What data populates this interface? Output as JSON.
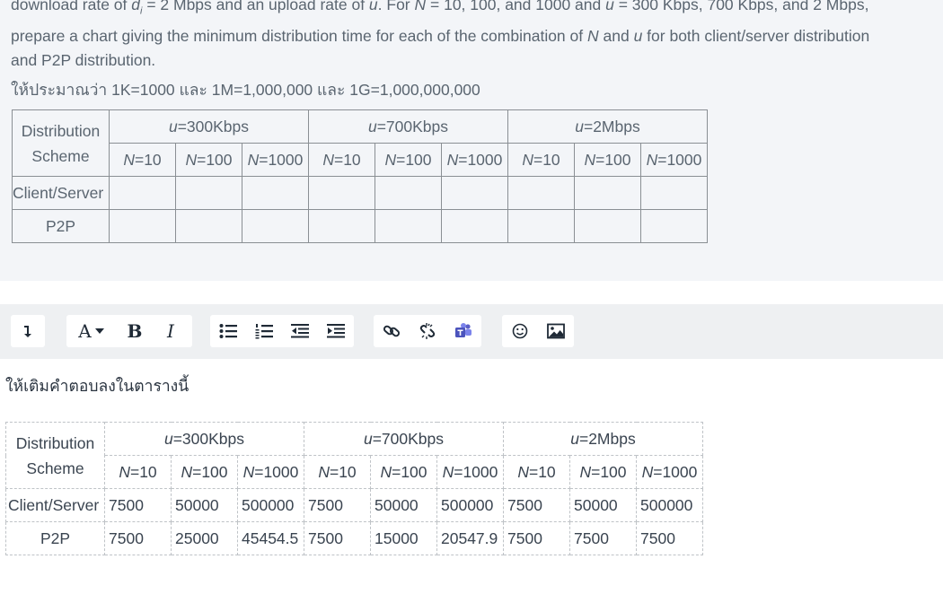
{
  "question": {
    "line1_a": "download rate of ",
    "line1_di": "d",
    "line1_di_sub": "i",
    "line1_b": " = 2 Mbps and an upload rate of ",
    "line1_u": "u",
    "line1_c": ". For ",
    "line1_N": "N",
    "line1_d": " = 10, 100, and 1000 and ",
    "line1_u2": "u",
    "line1_e": " = 300 Kbps, 700 Kbps, and 2 Mbps,",
    "line2_a": "prepare a chart giving the minimum distribution time for each of the combination of ",
    "line2_N": "N",
    "line2_b": " and ",
    "line2_u": "u",
    "line2_c": " for both client/server distribution",
    "line3": "and P2P distribution.",
    "thai_note": "ให้ประมาณว่า 1K=1000 และ 1M=1,000,000 และ 1G=1,000,000,000"
  },
  "table": {
    "scheme_header_1": "Distribution",
    "scheme_header_2": "Scheme",
    "u_var": "u",
    "groups": [
      "=300Kbps",
      "=700Kbps",
      "=2Mbps"
    ],
    "n_var": "N",
    "n_values": [
      "=10",
      "=100",
      "=1000"
    ],
    "row_labels": [
      "Client/Server",
      "P2P"
    ]
  },
  "toolbar": {
    "icons": [
      "collapse-toolbar-icon",
      "font-style-icon",
      "bold-icon",
      "italic-icon",
      "unordered-list-icon",
      "ordered-list-icon",
      "outdent-icon",
      "indent-icon",
      "link-icon",
      "unlink-icon",
      "teams-icon",
      "emoji-icon",
      "image-icon"
    ],
    "font_glyph": "A",
    "bold_glyph": "B",
    "italic_glyph": "I"
  },
  "answer": {
    "instruction": "ให้เติมคำตอบลงในตารางนี้",
    "client_server": [
      "7500",
      "50000",
      "500000",
      "7500",
      "50000",
      "500000",
      "7500",
      "50000",
      "500000"
    ],
    "p2p": [
      "7500",
      "25000",
      "45454.5",
      "7500",
      "15000",
      "20547.9",
      "7500",
      "7500",
      "7500"
    ]
  }
}
